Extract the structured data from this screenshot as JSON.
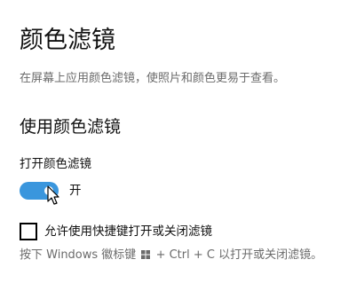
{
  "page": {
    "title": "颜色滤镜",
    "description": "在屏幕上应用颜色滤镜，使照片和颜色更易于查看。"
  },
  "section": {
    "title": "使用颜色滤镜"
  },
  "toggle": {
    "label": "打开颜色滤镜",
    "state_text": "开",
    "is_on": true,
    "accent_color": "#3a96dd"
  },
  "shortcut": {
    "checkbox_label": "允许使用快捷键打开或关闭滤镜",
    "checked": false,
    "hint_before_icon": "按下 Windows 徽标键 ",
    "hint_icon": "windows-logo-icon",
    "hint_after_icon": " + Ctrl + C 以打开或关闭滤镜。"
  }
}
